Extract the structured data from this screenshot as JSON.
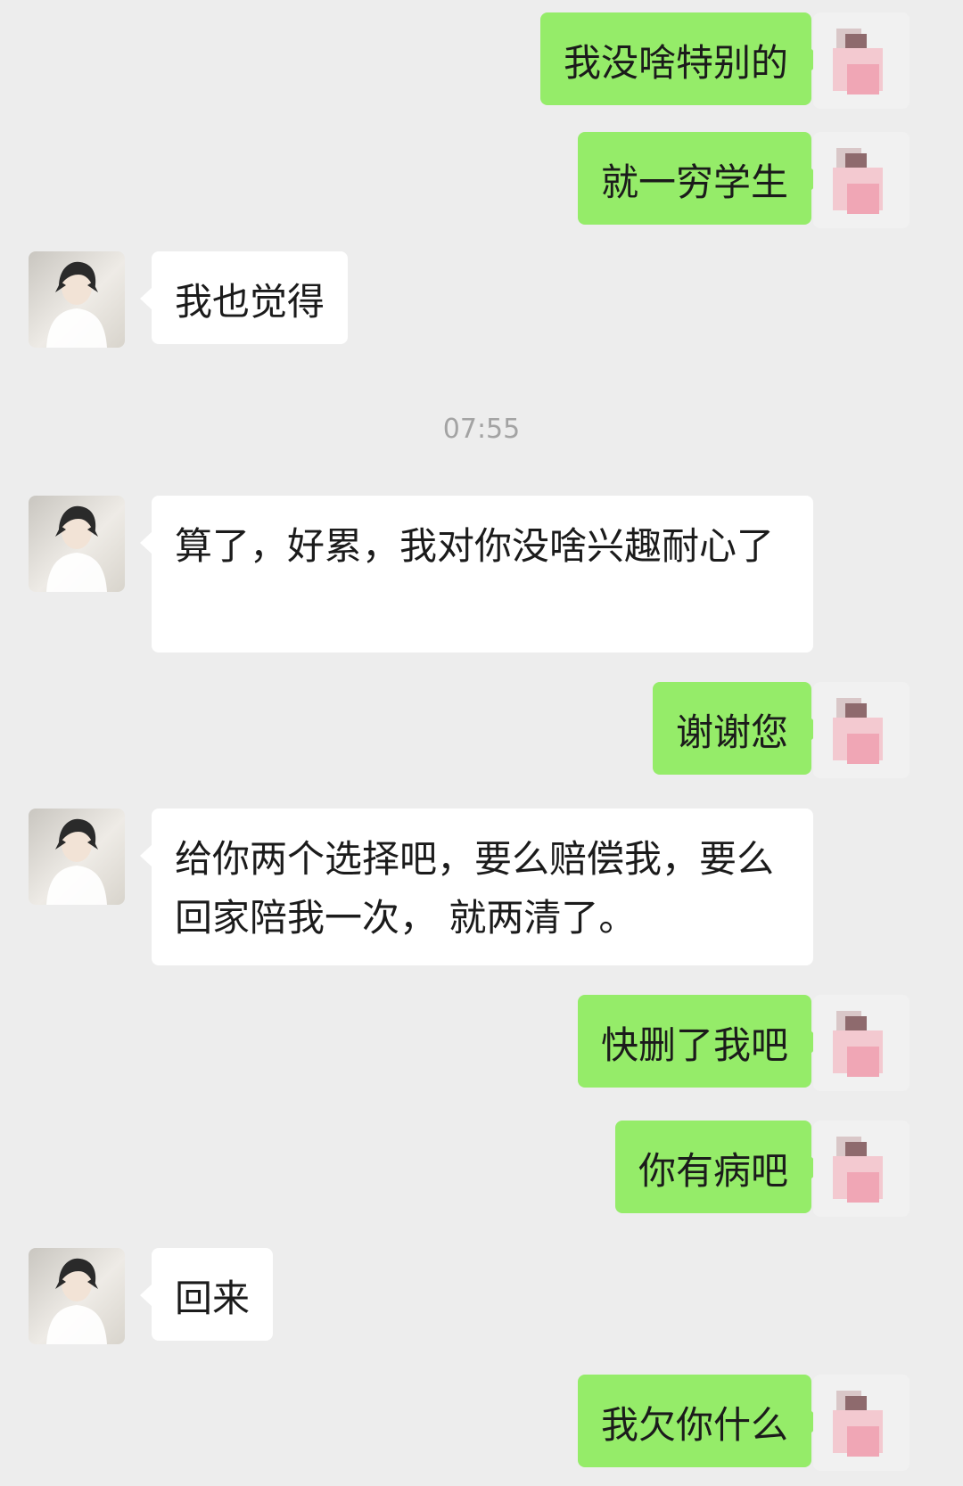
{
  "timestamp": "07:55",
  "messages": [
    {
      "side": "out",
      "text": "我没啥特别的"
    },
    {
      "side": "out",
      "text": "就一穷学生"
    },
    {
      "side": "in",
      "text": "我也觉得"
    },
    {
      "side": "in",
      "text": "算了，好累，我对你没啥兴趣耐心了"
    },
    {
      "side": "out",
      "text": "谢谢您"
    },
    {
      "side": "in",
      "text": "给你两个选择吧，要么赔偿我，要么回家陪我一次，  就两清了。"
    },
    {
      "side": "out",
      "text": "快删了我吧"
    },
    {
      "side": "out",
      "text": "你有病吧"
    },
    {
      "side": "in",
      "text": "回来"
    },
    {
      "side": "out",
      "text": "我欠你什么"
    }
  ],
  "colors": {
    "background": "#ededed",
    "outgoing_bubble": "#95ec69",
    "incoming_bubble": "#ffffff",
    "timestamp_text": "#a3a3a3"
  },
  "icons": {
    "my_avatar": "pixelated-avatar-icon",
    "their_avatar": "anime-avatar-icon"
  }
}
